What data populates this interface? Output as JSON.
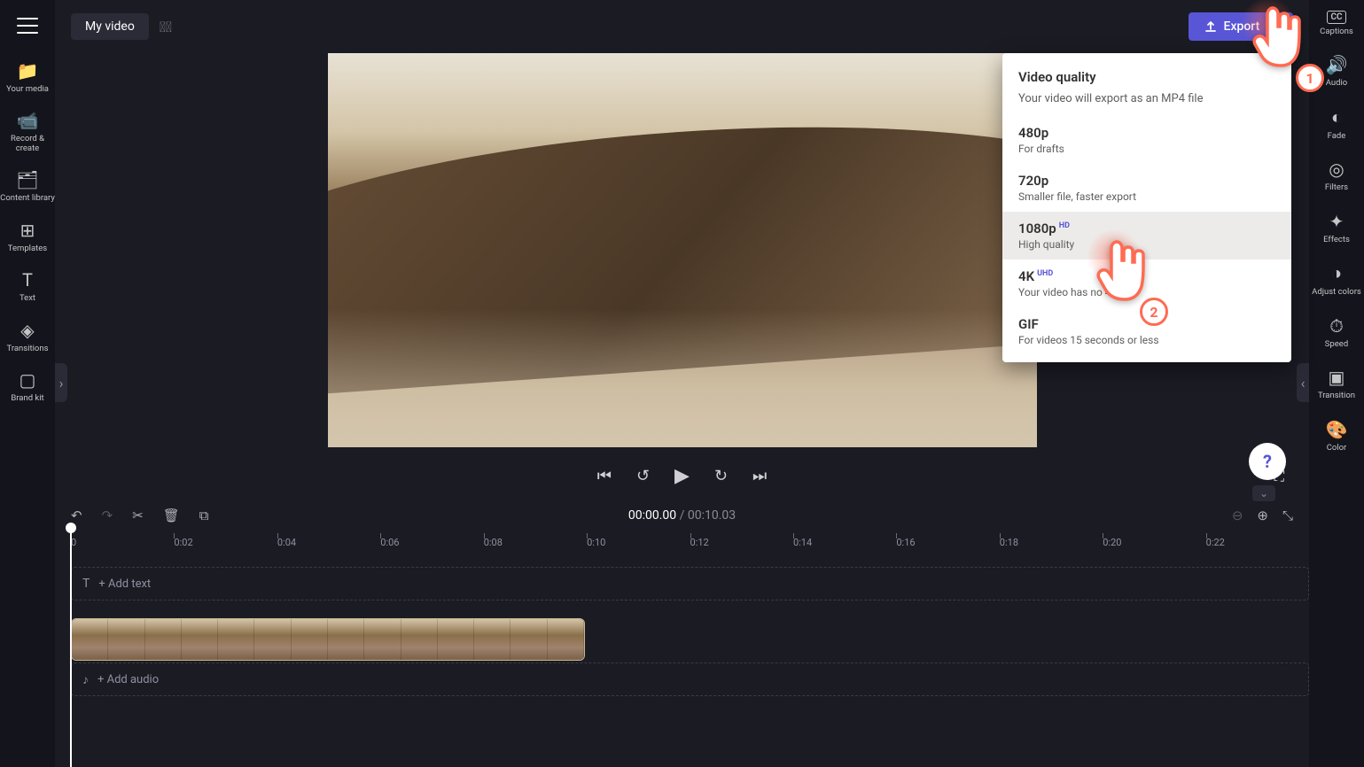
{
  "header": {
    "title": "My video",
    "export_label": "Export"
  },
  "left_nav": [
    {
      "label": "Your media",
      "icon": "folder"
    },
    {
      "label": "Record & create",
      "icon": "video-cam"
    },
    {
      "label": "Content library",
      "icon": "library"
    },
    {
      "label": "Templates",
      "icon": "grid"
    },
    {
      "label": "Text",
      "icon": "text"
    },
    {
      "label": "Transitions",
      "icon": "diamond"
    },
    {
      "label": "Brand kit",
      "icon": "card"
    }
  ],
  "right_nav": [
    {
      "label": "Captions",
      "icon": "cc"
    },
    {
      "label": "Audio",
      "icon": "speaker"
    },
    {
      "label": "Fade",
      "icon": "half-circle"
    },
    {
      "label": "Filters",
      "icon": "rings"
    },
    {
      "label": "Effects",
      "icon": "wand"
    },
    {
      "label": "Adjust colors",
      "icon": "contrast"
    },
    {
      "label": "Speed",
      "icon": "gauge"
    },
    {
      "label": "Transition",
      "icon": "slide"
    },
    {
      "label": "Color",
      "icon": "palette"
    }
  ],
  "time": {
    "elapsed": "00:00.00",
    "total": "00:10.03"
  },
  "ruler": [
    "0",
    "0:02",
    "0:04",
    "0:06",
    "0:08",
    "0:10",
    "0:12",
    "0:14",
    "0:16",
    "0:18",
    "0:20",
    "0:22"
  ],
  "tracks": {
    "text": "+ Add text",
    "audio": "+ Add audio"
  },
  "export_menu": {
    "title": "Video quality",
    "subtitle": "Your video will export as an MP4 file",
    "options": [
      {
        "q": "480p",
        "badge": "",
        "d": "For drafts"
      },
      {
        "q": "720p",
        "badge": "",
        "d": "Smaller file, faster export"
      },
      {
        "q": "1080p",
        "badge": "HD",
        "d": "High quality"
      },
      {
        "q": "4K",
        "badge": "UHD",
        "d": "Your video has no 4"
      },
      {
        "q": "GIF",
        "badge": "",
        "d": "For videos 15 seconds or less"
      }
    ]
  },
  "annotations": {
    "c1": "1",
    "c2": "2"
  }
}
